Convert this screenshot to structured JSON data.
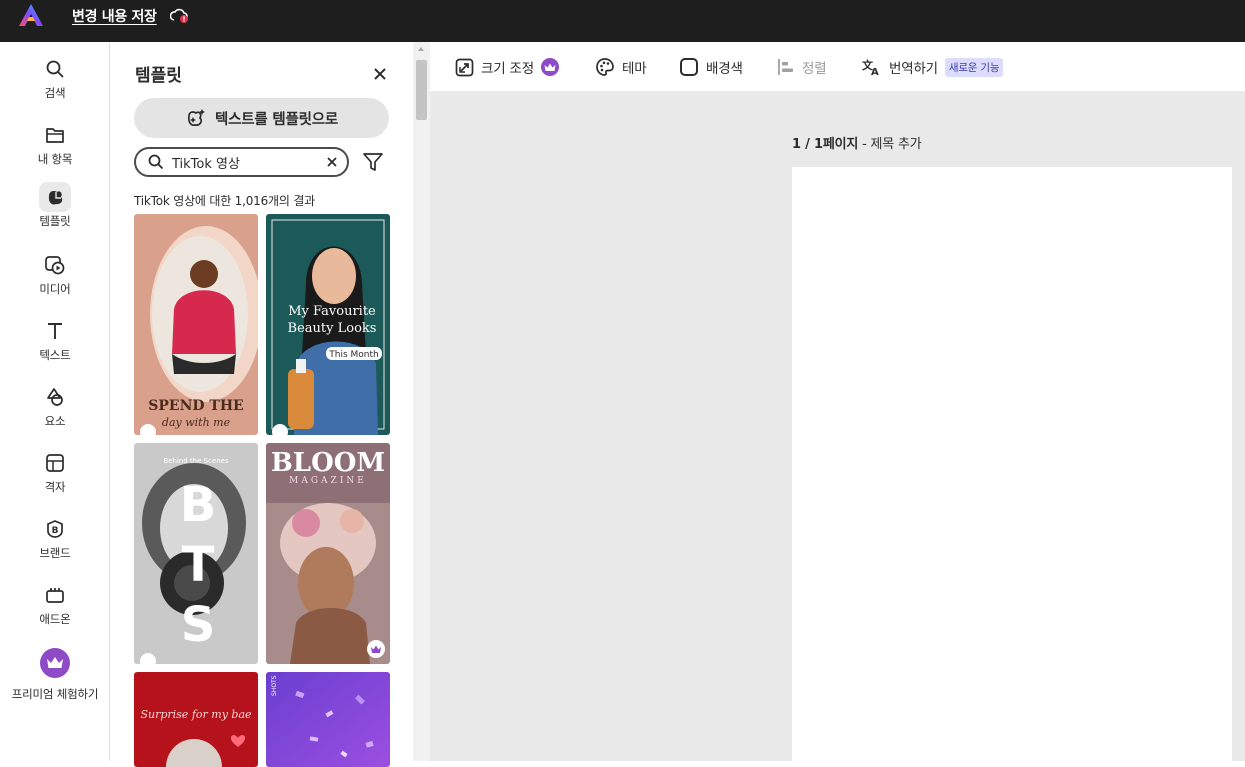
{
  "topbar": {
    "save_label": "변경 내용 저장"
  },
  "rail": {
    "items": [
      {
        "label": "검색",
        "icon": "search-icon"
      },
      {
        "label": "내 항목",
        "icon": "folder-icon"
      },
      {
        "label": "템플릿",
        "icon": "templates-icon"
      },
      {
        "label": "미디어",
        "icon": "media-icon"
      },
      {
        "label": "텍스트",
        "icon": "text-icon"
      },
      {
        "label": "요소",
        "icon": "shapes-icon"
      },
      {
        "label": "격자",
        "icon": "grid-icon"
      },
      {
        "label": "브랜드",
        "icon": "brand-icon"
      },
      {
        "label": "애드온",
        "icon": "addons-icon"
      },
      {
        "label": "프리미엄 체험하기",
        "icon": "crown-icon"
      }
    ],
    "active": "템플릿"
  },
  "panel": {
    "title": "템플릿",
    "text_to_template": "텍스트를 템플릿으로",
    "search_value": "TikTok 영상",
    "result_count": "TikTok 영상에 대한 1,016개의 결과",
    "thumbnails": [
      {
        "text_line1": "SPEND THE",
        "text_line2": "day with me"
      },
      {
        "text_line1": "My Favourite",
        "text_line2": "Beauty Looks",
        "tag": "This Month"
      },
      {
        "text_line1": "B",
        "text_line2": "T",
        "text_line3": "S",
        "top": "Behind the Scenes"
      },
      {
        "text_line1": "BLOOM",
        "text_line2": "MAGAZINE"
      },
      {
        "text_line1": "Surprise for my bae"
      },
      {
        "text_line1": "SHOTS"
      }
    ]
  },
  "toolbar": {
    "resize": "크기 조정",
    "theme": "테마",
    "background": "배경색",
    "align": "정렬",
    "translate": "번역하기",
    "new_badge": "새로운 기능"
  },
  "canvas": {
    "page_indicator": "1 / 1페이지",
    "separator": " - ",
    "add_title": "제목 추가"
  },
  "colors": {
    "topbar": "#1e1e1e",
    "premium": "#8e4bc5",
    "canvas_bg": "#e9e9e9",
    "new_badge_bg": "#dcdcff"
  }
}
